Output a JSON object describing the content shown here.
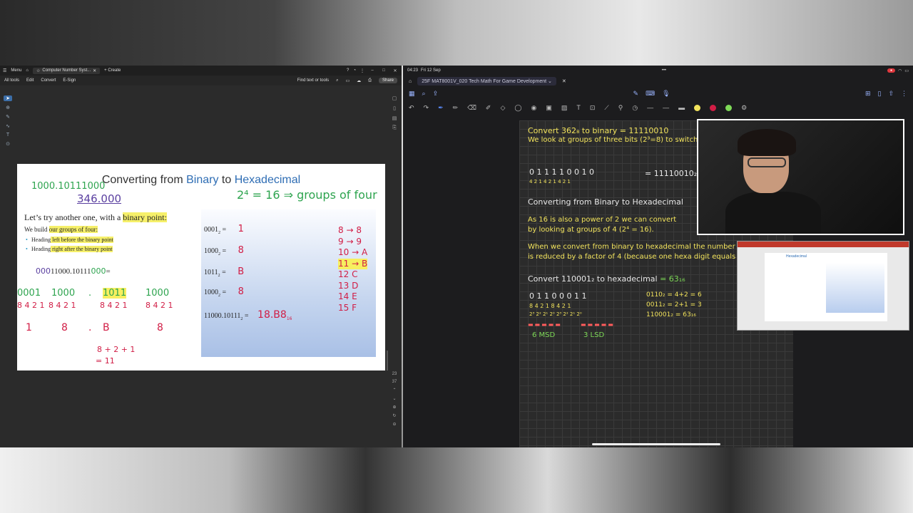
{
  "pdf": {
    "menu_label": "Menu",
    "tab_title": "Computer Number Syst...",
    "create_label": "Create",
    "menubar": [
      "All tools",
      "Edit",
      "Convert",
      "E-Sign"
    ],
    "find_placeholder": "Find text or tools",
    "share_label": "Share",
    "page_current": "23",
    "page_total": "37"
  },
  "slide": {
    "title_pre": "Converting from ",
    "title_binary": "Binary",
    "title_mid": " to ",
    "title_hex": "Hexadecimal",
    "lead_pre": "Let’s try another one, with a ",
    "lead_hl": "binary point:",
    "build_pre": "We build ",
    "build_hl": "our groups of four:",
    "bullet1_pre": "Heading",
    "bullet1_hl": " left before the binary point",
    "bullet2_pre": "Heading",
    "bullet2_hl": " right after the binary point",
    "problem_pad1": "000",
    "problem": "11000.10111",
    "problem_pad2": "000",
    "problem_eq": "=",
    "hw_top1": "1000.10111000",
    "hw_top2": "346.000",
    "hw_pow": "2⁴ = 16 ⇒ groups of four",
    "hw_groups": [
      "0001",
      "1000",
      ".",
      "1011",
      "1000"
    ],
    "hw_weights": [
      "8 4 2 1",
      "8 4 2 1",
      "8 4 2 1",
      "8 4 2 1"
    ],
    "hw_digits": [
      "1",
      "8",
      ".",
      "B",
      "8"
    ],
    "hw_sum": "8 + 2 + 1",
    "hw_sum_eq": "= 11",
    "panel_rows": [
      {
        "bin": "0001",
        "eq": "=",
        "hw": "1"
      },
      {
        "bin": "1000",
        "eq": "=",
        "hw": "8"
      },
      {
        "bin": "1011",
        "eq": "=",
        "hw": "B"
      },
      {
        "bin": "1000",
        "eq": "=",
        "hw": "8"
      }
    ],
    "panel_final": "11000.10111",
    "panel_final_sub": "2",
    "panel_final_eq": "=",
    "panel_final_answer": "18.B8",
    "panel_final_answer_sub": "16",
    "hex_map": [
      "8 → 8",
      "9 → 9",
      "10 → A",
      "11 → B",
      "12  C",
      "13  D",
      "14  E",
      "15  F"
    ]
  },
  "ipad": {
    "time": "04:23",
    "date": "Fri 12 Sep",
    "doc_title": "25F MAT8001V_020 Tech Math For Game Development",
    "colors": {
      "yellow": "#f2e35c",
      "red": "#ff5b5b",
      "green": "#7ed957",
      "accent": "#5b8cff"
    }
  },
  "notes": {
    "l1": "Convert 362₈ to binary = 11110010",
    "l2": "We look at groups of three bits (2³=8) to switch",
    "l3_bits": "0 1 1    1 1 0    0 1 0",
    "l3_w": "4 2 1    4 2 1    4 2 1",
    "l3_res": "= 11110010₂",
    "h2": "Converting from Binary to Hexadecimal",
    "p1": "As 16 is also a power of 2 we can convert",
    "p2": "by looking at groups of 4 (2⁴ = 16).",
    "p3": "When we convert from binary to hexadecimal the number of",
    "p4": "is reduced by a factor of 4 (because one hexa digit equals 4",
    "c1": "Convert 110001₂ to hexadecimal",
    "c1_ans": "= 63₁₆",
    "bits1": "0 1 1 0    0 0 1 1",
    "w1": "8 4 2 1    8 4 2 1",
    "pw1": "2³ 2² 2¹ 2⁰   2³ 2² 2¹ 2⁰",
    "s1": "0110₂ = 4+2 = 6",
    "s2": "0011₂ = 2+1 = 3",
    "s3": "110001₂ = 63₁₆",
    "msd": "6 MSD",
    "lsd": "3 LSD"
  }
}
